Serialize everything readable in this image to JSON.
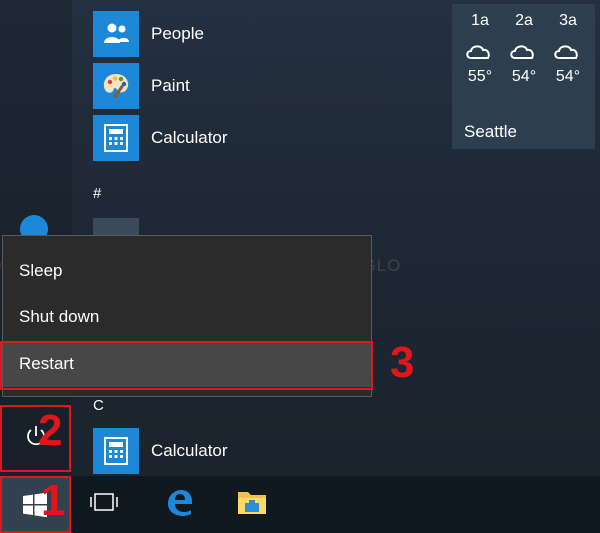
{
  "apps": {
    "people": "People",
    "paint": "Paint",
    "calculator": "Calculator",
    "calculator_c": "Calculator"
  },
  "sections": {
    "hash": "#",
    "c": "C"
  },
  "weather": {
    "times": [
      "1a",
      "2a",
      "3a"
    ],
    "temps": [
      "55°",
      "54°",
      "54°"
    ],
    "city": "Seattle"
  },
  "power_menu": {
    "sleep": "Sleep",
    "shut_down": "Shut down",
    "restart": "Restart"
  },
  "watermark": "© LINGLOM.COM     © LINGLOM.COM     © LINGLO",
  "callouts": {
    "one": "1",
    "two": "2",
    "three": "3"
  },
  "colors": {
    "tile_blue": "#1e88d8",
    "callout_red": "#e0161b",
    "menu_bg": "#2b2b2b",
    "menu_hover": "#474747"
  },
  "icons": {
    "people": "people-icon",
    "paint": "paint-palette-icon",
    "calculator": "calculator-icon",
    "power": "power-icon",
    "windows": "windows-logo-icon",
    "task_view": "task-view-icon",
    "edge": "edge-icon",
    "file_explorer": "file-explorer-icon",
    "weather": "partly-cloudy-night-icon"
  }
}
